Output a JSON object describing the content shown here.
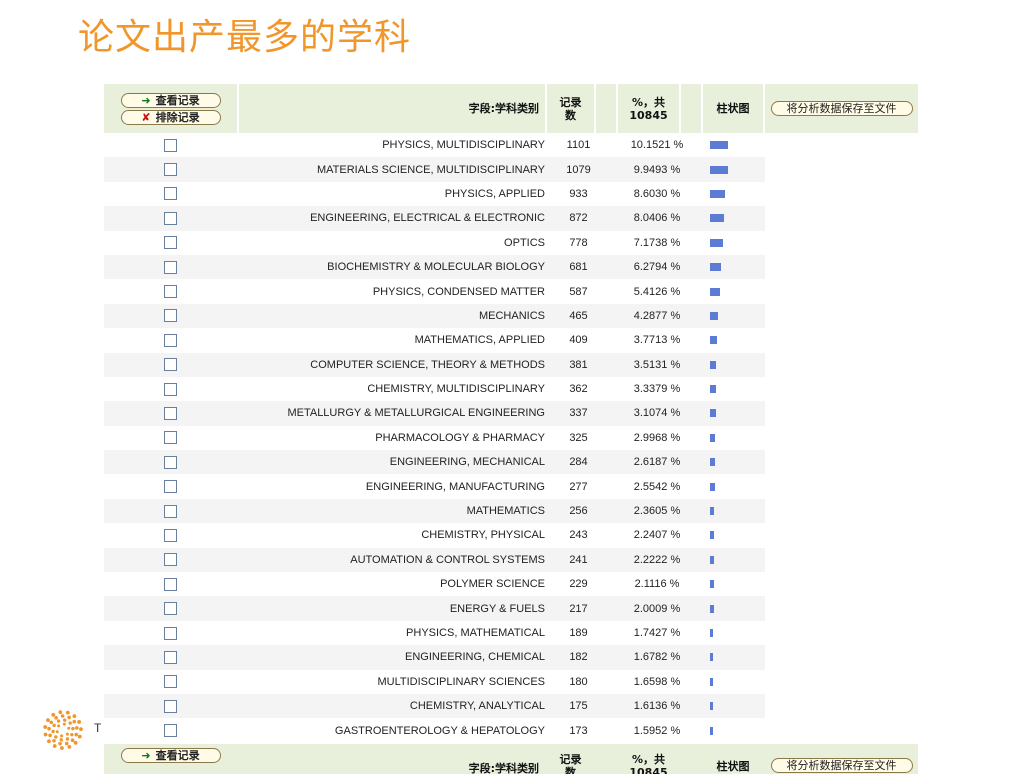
{
  "slide": {
    "title": "论文出产最多的学科"
  },
  "table": {
    "view_records_label": "查看记录",
    "exclude_records_label": "排除记录",
    "header_field": "字段:学科类别",
    "header_count": "记录\n数",
    "header_pct": "%，共\n10845",
    "header_bar": "柱状图",
    "save_label": "将分析数据保存至文件",
    "rows": [
      {
        "field": "PHYSICS, MULTIDISCIPLINARY",
        "count": "1101",
        "pct": "10.1521 %",
        "value": 10.1521
      },
      {
        "field": "MATERIALS SCIENCE, MULTIDISCIPLINARY",
        "count": "1079",
        "pct": "9.9493 %",
        "value": 9.9493
      },
      {
        "field": "PHYSICS, APPLIED",
        "count": "933",
        "pct": "8.6030 %",
        "value": 8.603
      },
      {
        "field": "ENGINEERING, ELECTRICAL & ELECTRONIC",
        "count": "872",
        "pct": "8.0406 %",
        "value": 8.0406
      },
      {
        "field": "OPTICS",
        "count": "778",
        "pct": "7.1738 %",
        "value": 7.1738
      },
      {
        "field": "BIOCHEMISTRY & MOLECULAR BIOLOGY",
        "count": "681",
        "pct": "6.2794 %",
        "value": 6.2794
      },
      {
        "field": "PHYSICS, CONDENSED MATTER",
        "count": "587",
        "pct": "5.4126 %",
        "value": 5.4126
      },
      {
        "field": "MECHANICS",
        "count": "465",
        "pct": "4.2877 %",
        "value": 4.2877
      },
      {
        "field": "MATHEMATICS, APPLIED",
        "count": "409",
        "pct": "3.7713 %",
        "value": 3.7713
      },
      {
        "field": "COMPUTER SCIENCE, THEORY & METHODS",
        "count": "381",
        "pct": "3.5131 %",
        "value": 3.5131
      },
      {
        "field": "CHEMISTRY, MULTIDISCIPLINARY",
        "count": "362",
        "pct": "3.3379 %",
        "value": 3.3379
      },
      {
        "field": "METALLURGY & METALLURGICAL ENGINEERING",
        "count": "337",
        "pct": "3.1074 %",
        "value": 3.1074
      },
      {
        "field": "PHARMACOLOGY & PHARMACY",
        "count": "325",
        "pct": "2.9968 %",
        "value": 2.9968
      },
      {
        "field": "ENGINEERING, MECHANICAL",
        "count": "284",
        "pct": "2.6187 %",
        "value": 2.6187
      },
      {
        "field": "ENGINEERING, MANUFACTURING",
        "count": "277",
        "pct": "2.5542 %",
        "value": 2.5542
      },
      {
        "field": "MATHEMATICS",
        "count": "256",
        "pct": "2.3605 %",
        "value": 2.3605
      },
      {
        "field": "CHEMISTRY, PHYSICAL",
        "count": "243",
        "pct": "2.2407 %",
        "value": 2.2407
      },
      {
        "field": "AUTOMATION & CONTROL SYSTEMS",
        "count": "241",
        "pct": "2.2222 %",
        "value": 2.2222
      },
      {
        "field": "POLYMER SCIENCE",
        "count": "229",
        "pct": "2.1116 %",
        "value": 2.1116
      },
      {
        "field": "ENERGY & FUELS",
        "count": "217",
        "pct": "2.0009 %",
        "value": 2.0009
      },
      {
        "field": "PHYSICS, MATHEMATICAL",
        "count": "189",
        "pct": "1.7427 %",
        "value": 1.7427
      },
      {
        "field": "ENGINEERING, CHEMICAL",
        "count": "182",
        "pct": "1.6782 %",
        "value": 1.6782
      },
      {
        "field": "MULTIDISCIPLINARY SCIENCES",
        "count": "180",
        "pct": "1.6598 %",
        "value": 1.6598
      },
      {
        "field": "CHEMISTRY, ANALYTICAL",
        "count": "175",
        "pct": "1.6136 %",
        "value": 1.6136
      },
      {
        "field": "GASTROENTEROLOGY & HEPATOLOGY",
        "count": "173",
        "pct": "1.5952 %",
        "value": 1.5952
      }
    ]
  },
  "logo": {
    "text": "T",
    "icon": "thomson-reuters-logo-icon"
  },
  "colors": {
    "title": "#f0962a",
    "header_bg": "#e8f0dc",
    "bar": "#5b7bd5"
  }
}
